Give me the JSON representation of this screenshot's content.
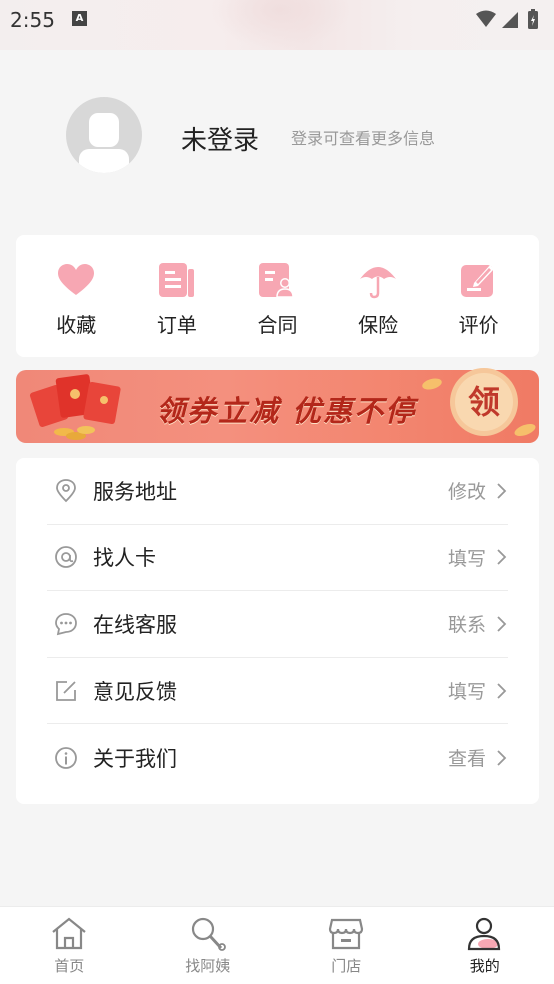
{
  "status_bar": {
    "time": "2:55",
    "notification_icon": "A"
  },
  "profile": {
    "title": "未登录",
    "subtitle": "登录可查看更多信息"
  },
  "quick_actions": [
    {
      "label": "收藏",
      "icon": "heart-icon"
    },
    {
      "label": "订单",
      "icon": "order-doc-icon"
    },
    {
      "label": "合同",
      "icon": "contract-icon"
    },
    {
      "label": "保险",
      "icon": "umbrella-icon"
    },
    {
      "label": "评价",
      "icon": "review-edit-icon"
    }
  ],
  "banner": {
    "text": "领券立减 优惠不停",
    "badge": "领"
  },
  "menu": [
    {
      "label": "服务地址",
      "action": "修改",
      "icon": "location-pin-icon"
    },
    {
      "label": "找人卡",
      "action": "填写",
      "icon": "at-sign-icon"
    },
    {
      "label": "在线客服",
      "action": "联系",
      "icon": "chat-bubble-icon"
    },
    {
      "label": "意见反馈",
      "action": "填写",
      "icon": "feedback-edit-icon"
    },
    {
      "label": "关于我们",
      "action": "查看",
      "icon": "info-icon"
    }
  ],
  "tabs": [
    {
      "label": "首页",
      "icon": "home-icon",
      "active": false
    },
    {
      "label": "找阿姨",
      "icon": "search-person-icon",
      "active": false
    },
    {
      "label": "门店",
      "icon": "store-icon",
      "active": false
    },
    {
      "label": "我的",
      "icon": "profile-icon",
      "active": true
    }
  ],
  "colors": {
    "accent_pink": "#f7a7b3",
    "banner_red": "#f08878",
    "badge_orange": "#f4b27a"
  }
}
